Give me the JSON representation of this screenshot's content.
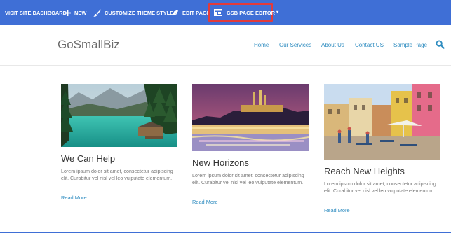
{
  "admin_bar": {
    "visit_dashboard": "VISIT SITE DASHBOARD",
    "new": "NEW",
    "customize": "CUSTOMIZE THEME STYLES",
    "edit_page": "EDIT PAGE",
    "gsb_editor": "GSB PAGE EDITOR",
    "caret": "▾",
    "icons": [
      "plus-icon",
      "brush-icon",
      "pencil-icon",
      "page-editor-icon"
    ]
  },
  "header": {
    "logo": "GoSmallBiz",
    "nav": [
      "Home",
      "Our Services",
      "About Us",
      "Contact US",
      "Sample Page"
    ],
    "search_icon": "search-icon"
  },
  "cards": [
    {
      "title": "We Can Help",
      "body": "Lorem ipsum dolor sit amet, consectetur adipiscing elit. Curabitur vel nisl vel leo vulputate elementum.",
      "link": "Read More"
    },
    {
      "title": "New Horizons",
      "body": "Lorem ipsum dolor sit amet, consectetur adipiscing elit. Curabitur vel nisl vel leo vulputate elementum.",
      "link": "Read More"
    },
    {
      "title": "Reach New Heights",
      "body": "Lorem ipsum dolor sit amet, consectetur adipiscing elit. Curabitur vel nisl vel leo vulputate elementum.",
      "link": "Read More"
    }
  ],
  "colors": {
    "admin_bar": "#3f6fd6",
    "highlight": "#e23b3b",
    "link": "#2e8cc0",
    "logo": "#6b6b6b"
  }
}
